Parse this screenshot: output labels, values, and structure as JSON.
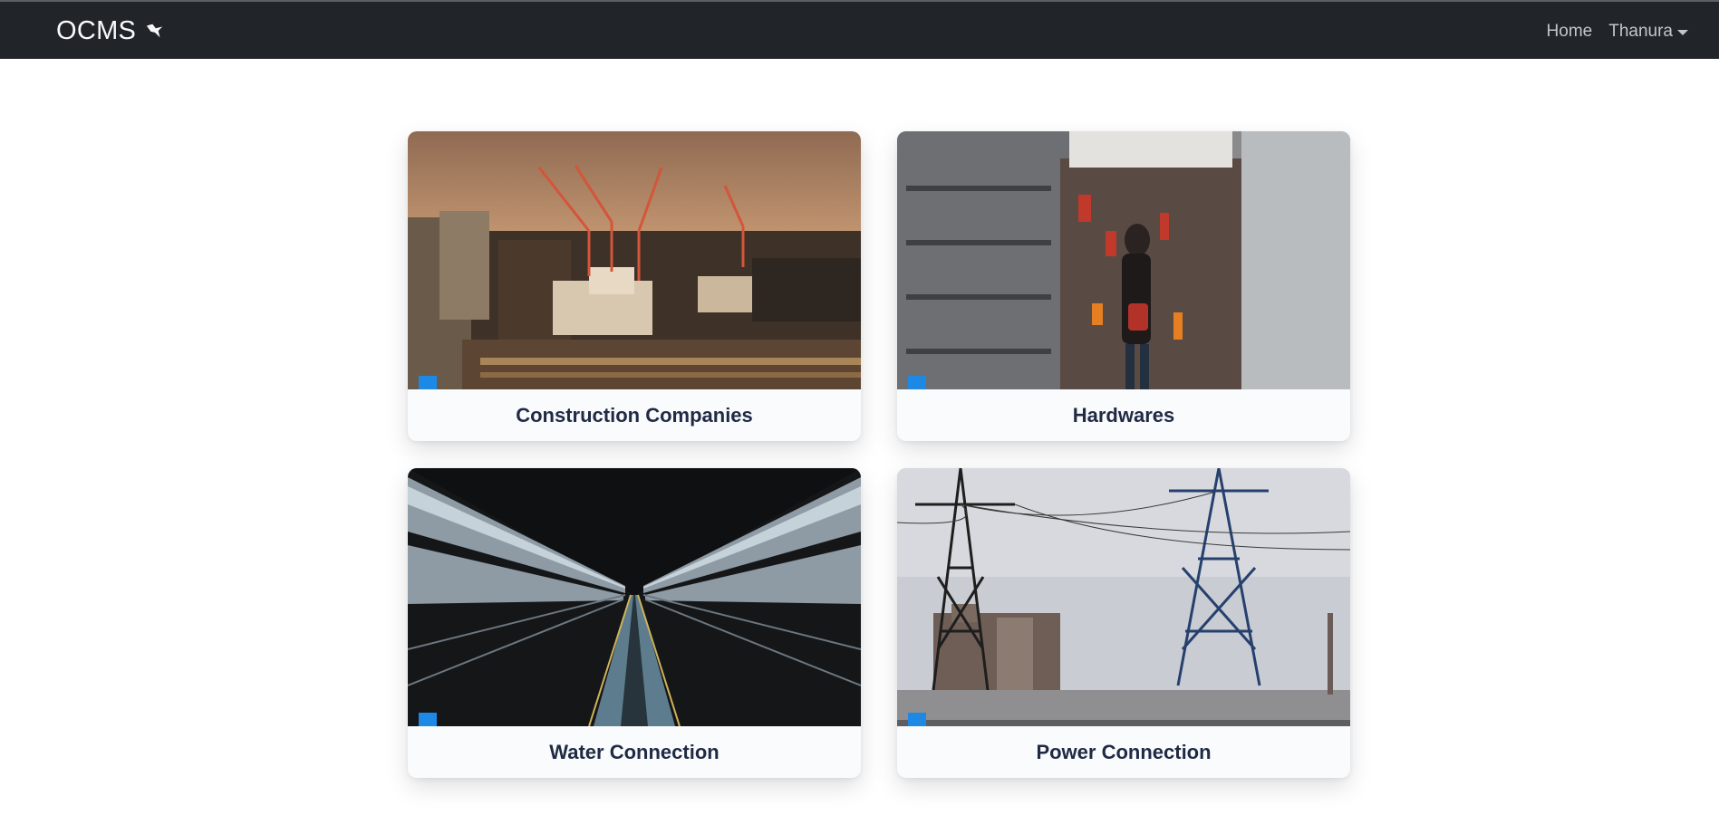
{
  "navbar": {
    "brand": "OCMS",
    "brand_icon": "bird-icon",
    "links": {
      "home": "Home",
      "user": "Thanura"
    }
  },
  "cards": [
    {
      "title": "Construction Companies",
      "image": "city-skyline-cranes-photo"
    },
    {
      "title": "Hardwares",
      "image": "hardware-store-shelves-photo"
    },
    {
      "title": "Water Connection",
      "image": "pipeline-tunnel-photo"
    },
    {
      "title": "Power Connection",
      "image": "power-transmission-towers-photo"
    }
  ],
  "colors": {
    "navbar_bg": "#212529",
    "badge": "#1e88e5",
    "card_title": "#1f2a44"
  }
}
